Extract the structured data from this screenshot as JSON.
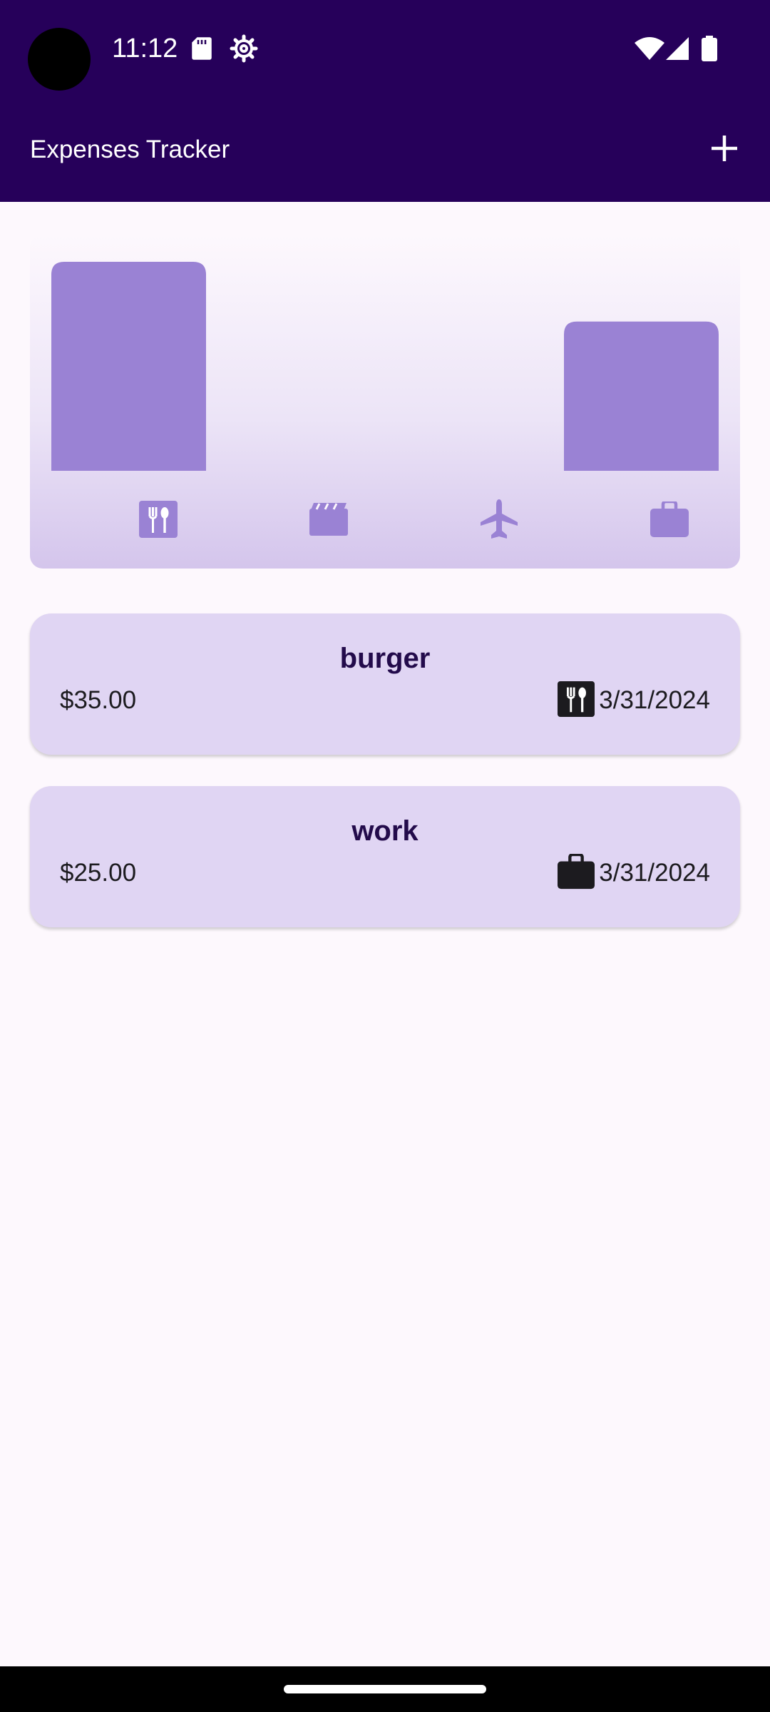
{
  "status_bar": {
    "time": "11:12",
    "left_icons": [
      "sd-card-icon",
      "settings-gear-icon"
    ],
    "right_icons": [
      "wifi-icon",
      "cellular-signal-icon",
      "battery-icon"
    ]
  },
  "app_bar": {
    "title": "Expenses Tracker",
    "action_icon": "add-icon",
    "background": "#26005a"
  },
  "chart_data": {
    "type": "bar",
    "title": "",
    "xlabel": "",
    "ylabel": "",
    "categories": [
      "food",
      "leisure",
      "travel",
      "work"
    ],
    "category_icons": [
      "restaurant-icon",
      "movie-icon",
      "flight-icon",
      "work-briefcase-icon"
    ],
    "values": [
      35,
      0,
      0,
      25
    ],
    "ylim": [
      0,
      35
    ],
    "bar_color": "#9a82d4",
    "grid": false
  },
  "expenses": [
    {
      "title": "burger",
      "amount": "$35.00",
      "category_icon": "restaurant-icon",
      "date": "3/31/2024"
    },
    {
      "title": "work",
      "amount": "$25.00",
      "category_icon": "work-briefcase-icon",
      "date": "3/31/2024"
    }
  ]
}
